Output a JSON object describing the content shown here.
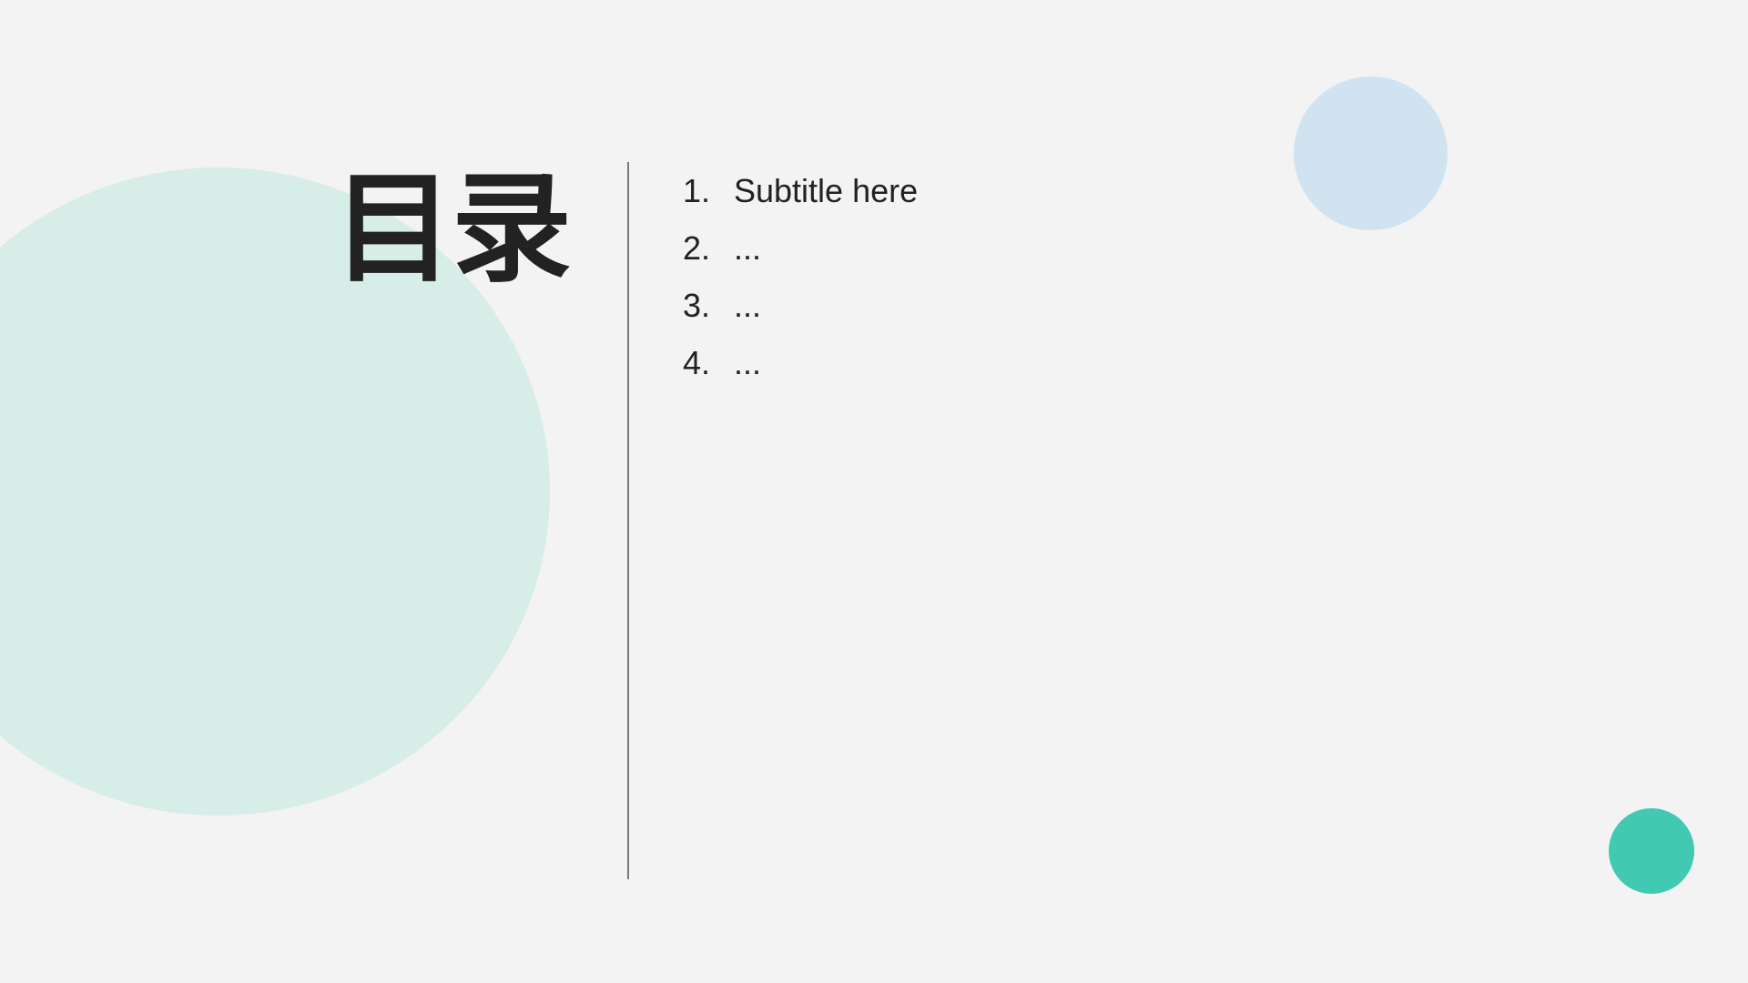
{
  "title": "目录",
  "colors": {
    "background": "#f3f3f3",
    "large_circle": "#d7ede7",
    "top_right_circle": "#cfe3f0",
    "bottom_right_circle": "#41c9b1",
    "text": "#222222",
    "divider": "#7a7a7a"
  },
  "toc": [
    {
      "number": "1.",
      "text": "Subtitle here"
    },
    {
      "number": "2.",
      "text": "..."
    },
    {
      "number": "3.",
      "text": "..."
    },
    {
      "number": "4.",
      "text": "..."
    }
  ]
}
